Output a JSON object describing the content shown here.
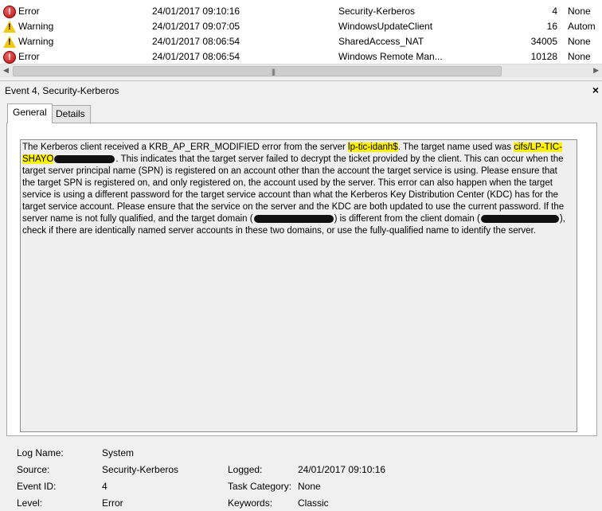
{
  "events": [
    {
      "level": "Error",
      "icon": "error-icon",
      "date": "24/01/2017 09:10:16",
      "source": "Security-Kerberos",
      "id": "4",
      "task": "None"
    },
    {
      "level": "Warning",
      "icon": "warning-icon",
      "date": "24/01/2017 09:07:05",
      "source": "WindowsUpdateClient",
      "id": "16",
      "task": "Autom"
    },
    {
      "level": "Warning",
      "icon": "warning-icon",
      "date": "24/01/2017 08:06:54",
      "source": "SharedAccess_NAT",
      "id": "34005",
      "task": "None"
    },
    {
      "level": "Error",
      "icon": "error-icon",
      "date": "24/01/2017 08:06:54",
      "source": "Windows Remote Man...",
      "id": "10128",
      "task": "None"
    }
  ],
  "detail": {
    "title": "Event 4, Security-Kerberos",
    "close": "×",
    "tabs": [
      "General",
      "Details"
    ],
    "message": {
      "p1": "The Kerberos client received a KRB_AP_ERR_MODIFIED error from the server ",
      "server": "lp-tic-idanh$",
      "p2": ". The target name used was ",
      "target": "cifs/LP-TIC-SHAYO",
      "p3": ". This indicates that the target server failed to decrypt the ticket provided by the client. This can occur when the target server principal name (SPN) is registered on an account other than the account the target service is using. Please ensure that the target SPN is registered on, and only registered on, the account used by the server. This error can also happen when the target service is using a different password for the target service account than what the Kerberos Key Distribution Center (KDC) has for the target service account. Please ensure that the service on the server and the KDC are both updated to use the current password. If the server name is not fully qualified, and the target domain (",
      "p4": ") is different from the client domain (",
      "p5": "), check if there are identically named server accounts in these two domains, or use the fully-qualified name to identify the server."
    }
  },
  "properties": {
    "log_name_label": "Log Name:",
    "log_name": "System",
    "source_label": "Source:",
    "source": "Security-Kerberos",
    "logged_label": "Logged:",
    "logged": "24/01/2017 09:10:16",
    "event_id_label": "Event ID:",
    "event_id": "4",
    "task_category_label": "Task Category:",
    "task_category": "None",
    "level_label": "Level:",
    "level": "Error",
    "keywords_label": "Keywords:",
    "keywords": "Classic"
  }
}
